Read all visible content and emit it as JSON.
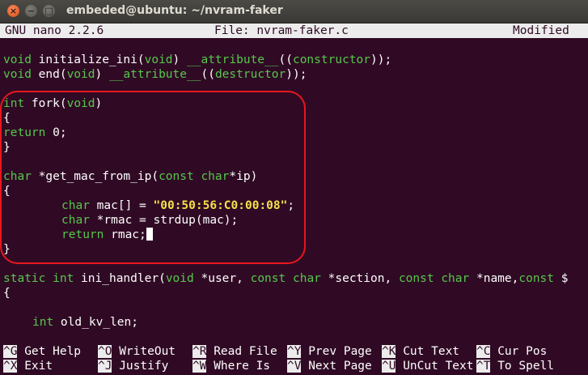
{
  "window": {
    "title": "embeded@ubuntu: ~/nvram-faker",
    "close_glyph": "×",
    "minimize_glyph": "−",
    "maximize_glyph": "□"
  },
  "nano": {
    "version": "GNU nano 2.2.6",
    "file": "File: nvram-faker.c",
    "status": "Modified"
  },
  "code": {
    "l1": {
      "t1": "void",
      "t2": " initialize_ini(",
      "t3": "void",
      "t4": ") ",
      "t5": "__attribute__",
      "t6": "((",
      "t7": "constructor",
      "t8": "));"
    },
    "l2": {
      "t1": "void",
      "t2": " end(",
      "t3": "void",
      "t4": ") ",
      "t5": "__attribute__",
      "t6": "((",
      "t7": "destructor",
      "t8": "));"
    },
    "l3": {
      "t1": "int",
      "t2": " fork(",
      "t3": "void",
      "t4": ")"
    },
    "l4": "{",
    "l5": {
      "t1": "return",
      "t2": " 0;"
    },
    "l6": "}",
    "l7": {
      "t1": "char",
      "t2": " *get_mac_from_ip(",
      "t3": "const",
      "t4": " ",
      "t5": "char",
      "t6": "*ip)"
    },
    "l8": "{",
    "l9": {
      "t1": "char",
      "t2": " mac[] = ",
      "t3": "\"00:50:56:C0:00:08\"",
      "t4": ";"
    },
    "l10": {
      "t1": "char",
      "t2": " *rmac = strdup(mac);"
    },
    "l11": {
      "t1": "return",
      "t2": " rmac;"
    },
    "l12": "}",
    "l13": {
      "t1": "static",
      "t2": " ",
      "t3": "int",
      "t4": " ini_handler(",
      "t5": "void",
      "t6": " *user, ",
      "t7": "const",
      "t8": " ",
      "t9": "char",
      "t10": " *section, ",
      "t11": "const",
      "t12": " ",
      "t13": "char",
      "t14": " *name,",
      "t15": "const",
      "t16": " $"
    },
    "l14": "{",
    "l15": {
      "t1": "int",
      "t2": " old_kv_len;"
    }
  },
  "shortcuts": [
    {
      "key": "^G",
      "label": " Get Help"
    },
    {
      "key": "^O",
      "label": " WriteOut"
    },
    {
      "key": "^R",
      "label": " Read File"
    },
    {
      "key": "^Y",
      "label": " Prev Page"
    },
    {
      "key": "^K",
      "label": " Cut Text"
    },
    {
      "key": "^C",
      "label": " Cur Pos"
    },
    {
      "key": "^X",
      "label": " Exit"
    },
    {
      "key": "^J",
      "label": " Justify"
    },
    {
      "key": "^W",
      "label": " Where Is"
    },
    {
      "key": "^V",
      "label": " Next Page"
    },
    {
      "key": "^U",
      "label": " UnCut Text"
    },
    {
      "key": "^T",
      "label": " To Spell"
    }
  ],
  "colors": {
    "background": "#300a24",
    "keyword": "#55c84c",
    "string": "#f4e04a",
    "annotation": "#e8161e"
  }
}
